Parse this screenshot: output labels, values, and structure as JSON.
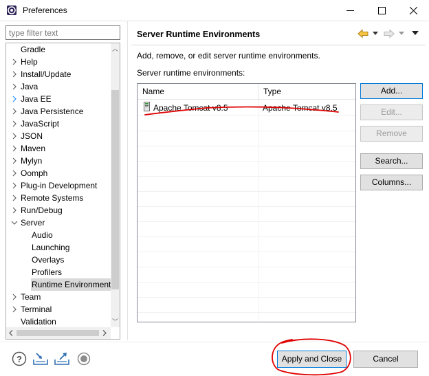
{
  "window": {
    "title": "Preferences"
  },
  "filter": {
    "placeholder": "type filter text"
  },
  "tree": {
    "items": [
      {
        "label": "Gradle",
        "indent": 0,
        "twisty": "none"
      },
      {
        "label": "Help",
        "indent": 0,
        "twisty": "collapsed"
      },
      {
        "label": "Install/Update",
        "indent": 0,
        "twisty": "collapsed"
      },
      {
        "label": "Java",
        "indent": 0,
        "twisty": "collapsed"
      },
      {
        "label": "Java EE",
        "indent": 0,
        "twisty": "collapsed-blue"
      },
      {
        "label": "Java Persistence",
        "indent": 0,
        "twisty": "collapsed"
      },
      {
        "label": "JavaScript",
        "indent": 0,
        "twisty": "collapsed"
      },
      {
        "label": "JSON",
        "indent": 0,
        "twisty": "collapsed"
      },
      {
        "label": "Maven",
        "indent": 0,
        "twisty": "collapsed"
      },
      {
        "label": "Mylyn",
        "indent": 0,
        "twisty": "collapsed"
      },
      {
        "label": "Oomph",
        "indent": 0,
        "twisty": "collapsed"
      },
      {
        "label": "Plug-in Development",
        "indent": 0,
        "twisty": "collapsed"
      },
      {
        "label": "Remote Systems",
        "indent": 0,
        "twisty": "collapsed"
      },
      {
        "label": "Run/Debug",
        "indent": 0,
        "twisty": "collapsed"
      },
      {
        "label": "Server",
        "indent": 0,
        "twisty": "expanded"
      },
      {
        "label": "Audio",
        "indent": 1,
        "twisty": "none"
      },
      {
        "label": "Launching",
        "indent": 1,
        "twisty": "none"
      },
      {
        "label": "Overlays",
        "indent": 1,
        "twisty": "none"
      },
      {
        "label": "Profilers",
        "indent": 1,
        "twisty": "none"
      },
      {
        "label": "Runtime Environments",
        "indent": 1,
        "twisty": "none",
        "selected": true
      },
      {
        "label": "Team",
        "indent": 0,
        "twisty": "collapsed"
      },
      {
        "label": "Terminal",
        "indent": 0,
        "twisty": "collapsed"
      },
      {
        "label": "Validation",
        "indent": 0,
        "twisty": "none"
      }
    ]
  },
  "page": {
    "title": "Server Runtime Environments",
    "description": "Add, remove, or edit server runtime environments.",
    "list_label": "Server runtime environments:"
  },
  "table": {
    "columns": [
      "Name",
      "Type"
    ],
    "rows": [
      {
        "name": "Apache Tomcat v8.5",
        "type": "Apache Tomcat v8.5",
        "icon": "server-icon"
      }
    ]
  },
  "buttons": {
    "add": "Add...",
    "edit": "Edit...",
    "remove": "Remove",
    "search": "Search...",
    "columns": "Columns...",
    "apply_close": "Apply and Close",
    "cancel": "Cancel"
  },
  "colors": {
    "accent": "#0078d7",
    "annotation": "#e00000",
    "selection": "#d9d9d9",
    "nav_back": "#e8a317"
  },
  "icons": [
    "eclipse-icon",
    "minimize-icon",
    "maximize-icon",
    "close-icon",
    "back-arrow-icon",
    "forward-arrow-icon",
    "menu-chevron-icon",
    "help-icon",
    "import-icon",
    "export-icon",
    "record-icon",
    "server-icon"
  ]
}
